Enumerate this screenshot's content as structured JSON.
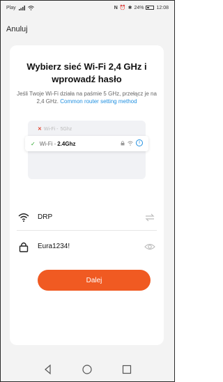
{
  "status_bar": {
    "carrier": "Play",
    "battery": "24%",
    "time": "12:08",
    "icons": [
      "signal-icon",
      "wifi-icon",
      "nfc-icon",
      "alarm-icon",
      "bluetooth-icon",
      "battery-icon"
    ]
  },
  "header": {
    "cancel_label": "Anuluj"
  },
  "content": {
    "title": "Wybierz sieć Wi-Fi 2,4 GHz i wprowadź hasło",
    "description": "Jeśli Twoje Wi-Fi działa na paśmie 5 GHz, przełącz je na 2,4 GHz.",
    "link_label": "Common router setting method"
  },
  "illustration": {
    "row_5ghz": {
      "name": "Wi-Fi - ",
      "band": "5Ghz"
    },
    "row_24ghz": {
      "name": "Wi-Fi - ",
      "band": "2.4Ghz"
    }
  },
  "form": {
    "ssid_value": "DRP",
    "password_value": "Eura1234!"
  },
  "actions": {
    "next_label": "Dalej"
  },
  "colors": {
    "accent": "#f05a22",
    "link": "#1f8fe0",
    "check": "#2aa52a",
    "error": "#e2402a"
  }
}
